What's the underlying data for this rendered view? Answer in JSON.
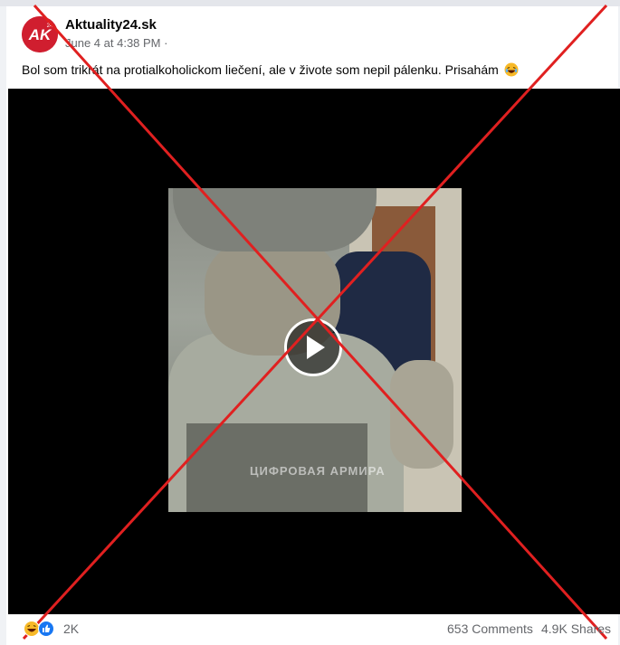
{
  "post": {
    "page_name": "Aktuality24.sk",
    "timestamp": "June 4 at 4:38 PM",
    "separator": " ·",
    "avatar_text": "AK",
    "text": "Bol som trikrát na protialkoholickom liečení, ale v živote som nepil pálenku. Prisahám",
    "text_emoji": "laughing-emoji"
  },
  "video": {
    "watermark": "ЦИФРОВАЯ АРМИРА",
    "play_icon": "play-icon"
  },
  "overlay": {
    "cross_color": "#e02020"
  },
  "footer": {
    "reactions": [
      "haha",
      "like"
    ],
    "reaction_count": "2K",
    "comments": "653 Comments",
    "shares": "4.9K Shares"
  }
}
